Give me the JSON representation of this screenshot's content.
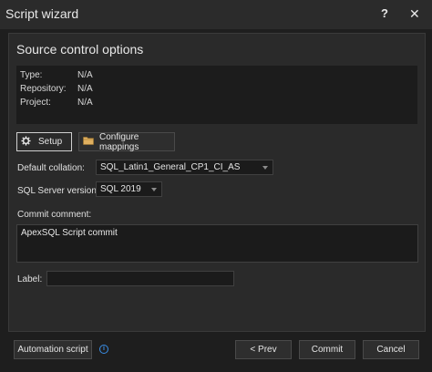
{
  "window": {
    "title": "Script wizard",
    "help_icon": "?",
    "close_icon": "✕"
  },
  "section": {
    "title": "Source control options"
  },
  "info": {
    "rows": [
      {
        "key": "Type:",
        "value": "N/A"
      },
      {
        "key": "Repository:",
        "value": "N/A"
      },
      {
        "key": "Project:",
        "value": "N/A"
      }
    ]
  },
  "actions": {
    "setup_label": "Setup",
    "setup_icon": "gear-icon",
    "mappings_label": "Configure mappings",
    "mappings_icon": "folder-icon"
  },
  "form": {
    "collation_label": "Default collation:",
    "collation_value": "SQL_Latin1_General_CP1_CI_AS",
    "server_label": "SQL Server version:",
    "server_value": "SQL 2019",
    "comment_label": "Commit comment:",
    "comment_value": "ApexSQL Script commit",
    "label_label": "Label:",
    "label_value": ""
  },
  "footer": {
    "automation_label": "Automation script",
    "prev_label": "< Prev",
    "commit_label": "Commit",
    "cancel_label": "Cancel"
  },
  "colors": {
    "accent_info": "#3a8ee6",
    "folder": "#e0b060"
  }
}
